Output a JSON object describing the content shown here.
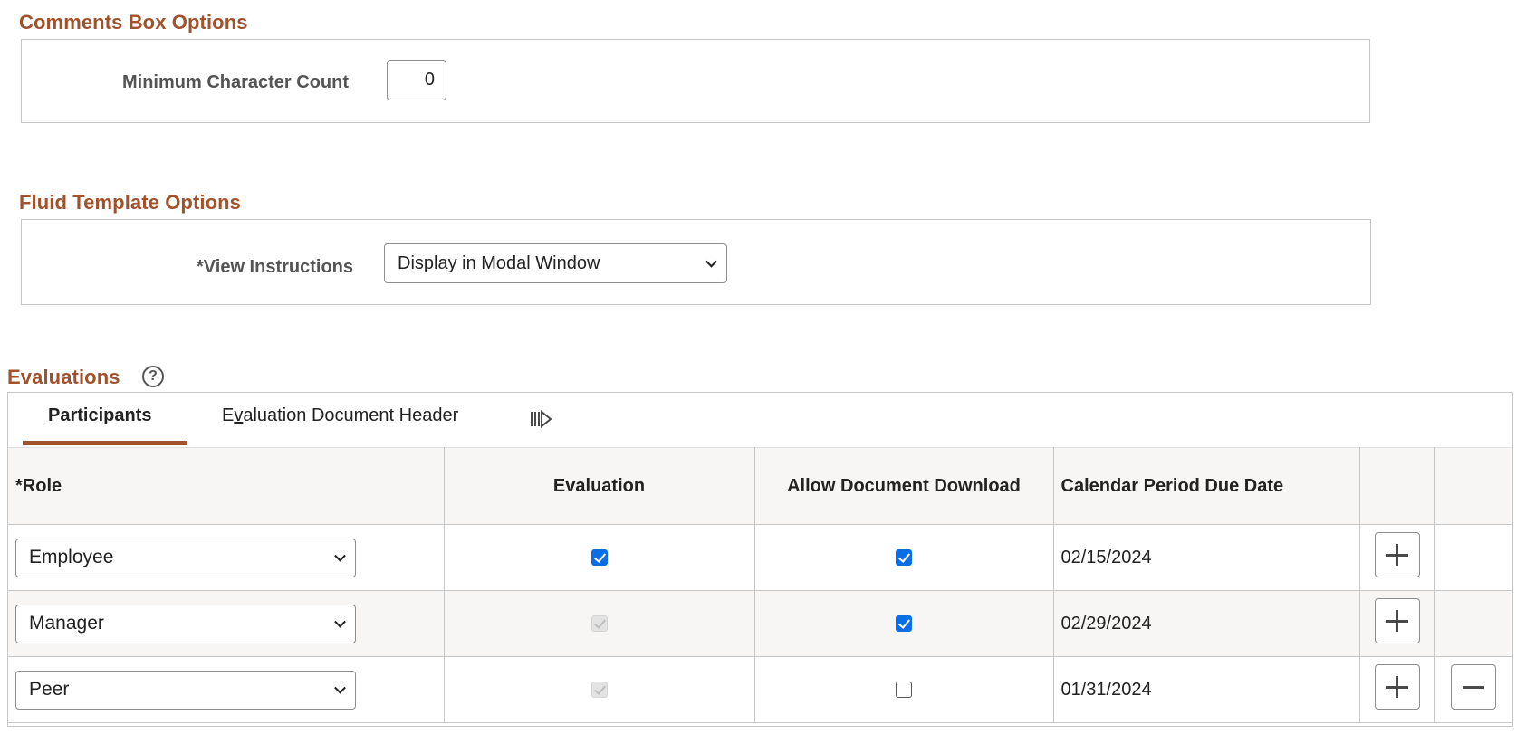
{
  "comments_box": {
    "title": "Comments Box Options",
    "min_char_label": "Minimum Character Count",
    "min_char_value": "0"
  },
  "fluid_template": {
    "title": "Fluid Template Options",
    "view_instructions_label": "*View Instructions",
    "view_instructions_value": "Display in Modal Window"
  },
  "evaluations": {
    "title": "Evaluations",
    "help_glyph": "?",
    "tabs": [
      {
        "label": "Participants",
        "active": true
      },
      {
        "label_pre": "E",
        "label_access": "v",
        "label_post": "aluation Document Header",
        "active": false
      }
    ],
    "show_all_columns_icon": "show-all-columns-icon",
    "columns": [
      "*Role",
      "Evaluation",
      "Allow Document Download",
      "Calendar Period Due Date"
    ],
    "rows": [
      {
        "role": "Employee",
        "evaluation": "checked",
        "allow_download": "checked",
        "due_date": "02/15/2024",
        "can_delete": false
      },
      {
        "role": "Manager",
        "evaluation": "checked-disabled",
        "allow_download": "checked",
        "due_date": "02/29/2024",
        "can_delete": false
      },
      {
        "role": "Peer",
        "evaluation": "checked-disabled",
        "allow_download": "unchecked",
        "due_date": "01/31/2024",
        "can_delete": true
      }
    ],
    "accent_color": "#a0522d",
    "checkbox_color": "#0b6ee6"
  }
}
